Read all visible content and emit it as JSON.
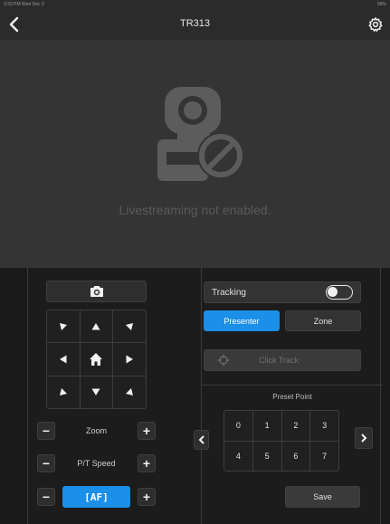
{
  "status_bar": {
    "time": "3:33 PM  Wed Dec 3",
    "indicators": "99%"
  },
  "header": {
    "title": "TR313",
    "back_icon": "chevron-left-icon",
    "settings_icon": "gear-icon"
  },
  "video": {
    "message": "Livestreaming not enabled."
  },
  "controls": {
    "zoom_label": "Zoom",
    "pt_speed_label": "P/T Speed",
    "af_label": "[AF]",
    "minus": "−",
    "plus": "+"
  },
  "tracking": {
    "label": "Tracking",
    "enabled": false,
    "presenter_label": "Presenter",
    "zone_label": "Zone",
    "click_track_label": "Click Track"
  },
  "presets": {
    "title": "Preset Point",
    "points": [
      "0",
      "1",
      "2",
      "3",
      "4",
      "5",
      "6",
      "7"
    ],
    "save_label": "Save"
  },
  "colors": {
    "accent": "#1c8fe8",
    "background": "#1e1e1e",
    "video_bg": "#343434"
  }
}
